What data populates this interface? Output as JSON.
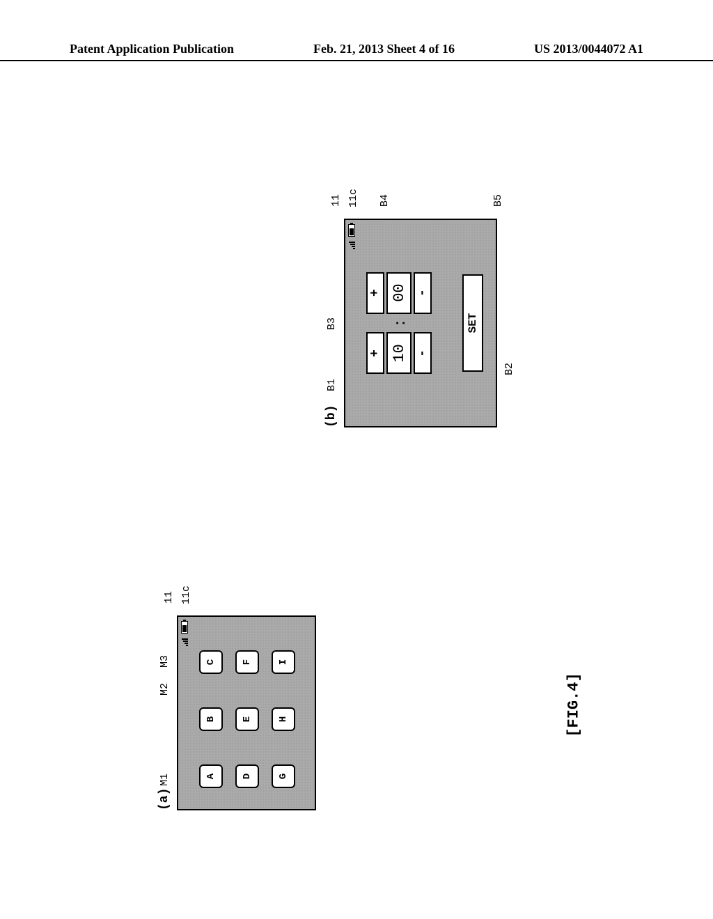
{
  "header": {
    "left": "Patent Application Publication",
    "center": "Feb. 21, 2013  Sheet 4 of 16",
    "right": "US 2013/0044072 A1"
  },
  "figure_label": "[FIG.4]",
  "panel_a": {
    "label": "(a)",
    "callout_11": "11",
    "callout_11c": "11c",
    "callout_m1": "M1",
    "callout_m2": "M2",
    "callout_m3": "M3",
    "menu_items": [
      "A",
      "B",
      "C",
      "D",
      "E",
      "F",
      "G",
      "H",
      "I"
    ]
  },
  "panel_b": {
    "label": "(b)",
    "callout_11": "11",
    "callout_11c": "11c",
    "callout_b1": "B1",
    "callout_b2": "B2",
    "callout_b3": "B3",
    "callout_b4": "B4",
    "callout_b5": "B5",
    "plus": "+",
    "minus": "-",
    "hour_val": "10",
    "min_val": "00",
    "colon": ":",
    "set_label": "SET"
  }
}
